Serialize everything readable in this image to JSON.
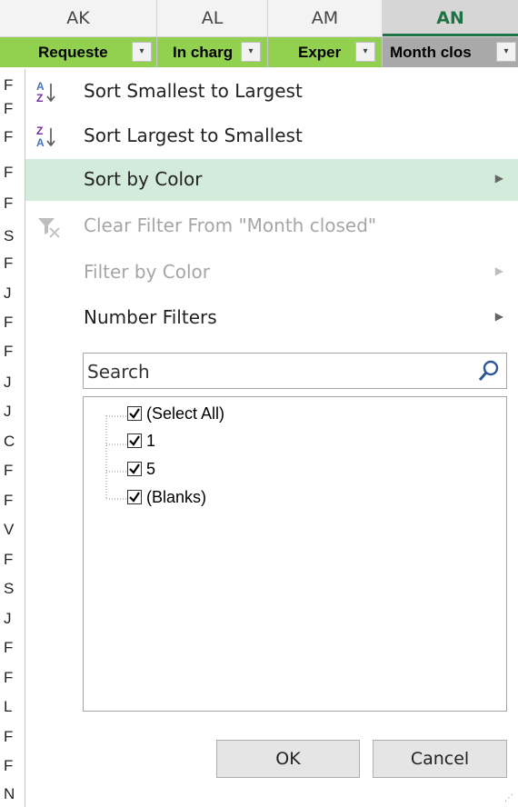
{
  "columns": [
    {
      "letter": "AK",
      "header": "Requeste"
    },
    {
      "letter": "AL",
      "header": "In charg"
    },
    {
      "letter": "AM",
      "header": "Exper"
    },
    {
      "letter": "AN",
      "header": "Month clos"
    }
  ],
  "left_cells": [
    "F",
    "F",
    "F",
    "F",
    "F",
    "S",
    "F",
    "J",
    "F",
    "F",
    "J",
    "J",
    "C",
    "F",
    "F",
    "V",
    "F",
    "S",
    "J",
    "F",
    "F",
    "L",
    "F",
    "F",
    "N"
  ],
  "menu": {
    "sort_asc": {
      "label": "Sort Smallest to Largest",
      "icon": "sort-ascending-icon"
    },
    "sort_desc": {
      "label": "Sort Largest to Smallest",
      "icon": "sort-descending-icon"
    },
    "sort_color": {
      "label": "Sort by Color"
    },
    "clear_filter": {
      "label": "Clear Filter From \"Month closed\"",
      "icon": "clear-filter-icon"
    },
    "filter_color": {
      "label": "Filter by Color"
    },
    "number_filters": {
      "label": "Number Filters"
    }
  },
  "search": {
    "placeholder": "Search",
    "icon": "search-icon"
  },
  "list": [
    {
      "label": "(Select All)",
      "checked": true
    },
    {
      "label": "1",
      "checked": true
    },
    {
      "label": "5",
      "checked": true
    },
    {
      "label": "(Blanks)",
      "checked": true
    }
  ],
  "buttons": {
    "ok": "OK",
    "cancel": "Cancel"
  },
  "colors": {
    "highlight": "#d3ebda",
    "header_green": "#92d050",
    "selected_col_text": "#217346"
  }
}
